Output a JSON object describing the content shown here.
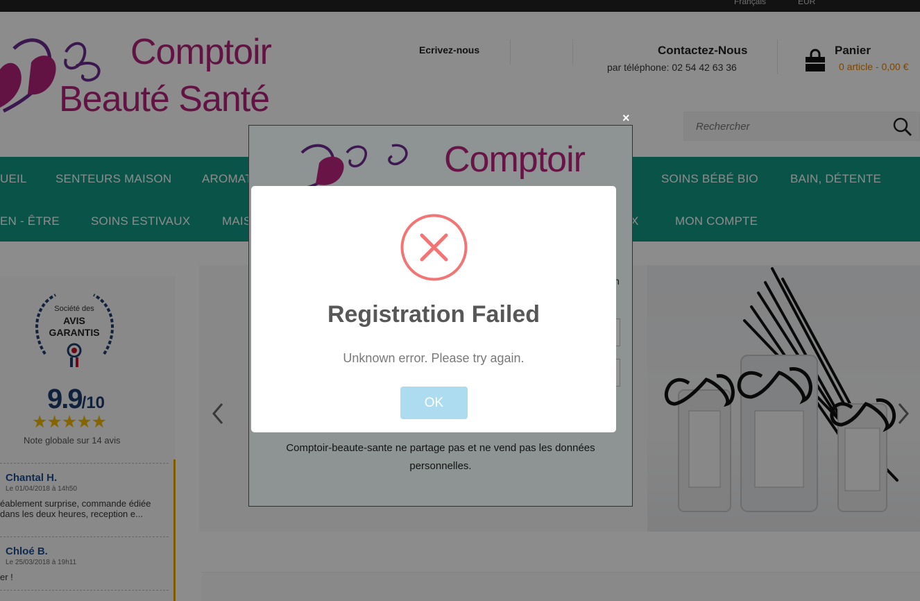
{
  "topbar": {
    "language": "Français",
    "currency": "EUR"
  },
  "header": {
    "logo_line1": "Comptoir",
    "logo_line2": "Beauté Santé",
    "write_us": "Ecrivez-nous",
    "contact_title": "Contactez-Nous",
    "contact_phone": "par téléphone: 02 54 42 63 36",
    "cart_title": "Panier",
    "cart_info": "0 article - 0,00 €",
    "search_placeholder": "Rechercher"
  },
  "nav": {
    "row1": [
      "UEIL",
      "SENTEURS MAISON",
      "AROMAT",
      "SOINS BÉBÉ BIO",
      "BAIN, DÉTENTE"
    ],
    "row2": [
      "EN - ÊTRE",
      "SOINS ESTIVAUX",
      "MAIS",
      "X",
      "MON COMPTE"
    ]
  },
  "reviews": {
    "badge_line1": "Société des",
    "badge_line2": "AVIS",
    "badge_line3": "GARANTIS",
    "score": "9.9",
    "score_max": "/10",
    "stars": "★★★★★",
    "global_note": "Note globale sur 14 avis",
    "items": [
      {
        "name": "Chantal H.",
        "date": "Le 01/04/2018 à 14h50",
        "text": "éablement surprise, commande édiée dans les deux heures, reception e..."
      },
      {
        "name": "Chloé B.",
        "date": "Le 25/03/2018 à 19h11",
        "text": "er !"
      }
    ]
  },
  "signup_modal": {
    "logo_text": "Comptoir",
    "partial_char": "n",
    "privacy_text": "Comptoir-beaute-sante ne partage pas et ne vend pas les données personnelles.",
    "close": "×"
  },
  "alert": {
    "title": "Registration Failed",
    "message": "Unknown error. Please try again.",
    "ok_label": "OK",
    "icon": "error-x-icon",
    "icon_color": "#f27474",
    "button_color": "#addcf1"
  },
  "colors": {
    "brand": "#b5247a",
    "nav_bg": "#139884",
    "cart_accent": "#e08000"
  }
}
